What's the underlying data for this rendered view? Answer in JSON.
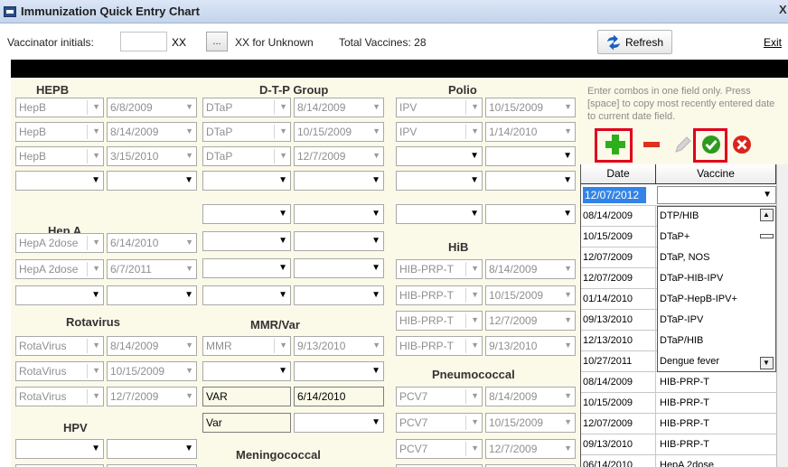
{
  "window": {
    "title": "Immunization Quick Entry Chart",
    "close_label": "X"
  },
  "toolbar": {
    "vaccinator_label": "Vaccinator initials:",
    "vaccinator_value": "",
    "xx_value": "XX",
    "dots_label": "...",
    "xx_unknown_label": "XX for Unknown",
    "total_label": "Total Vaccines: 28",
    "refresh_label": "Refresh",
    "exit_label": "Exit"
  },
  "sections": {
    "hepb": "HEPB",
    "dtp": "D-T-P Group",
    "polio": "Polio",
    "hepa": "Hep A",
    "hib": "HiB",
    "rota": "Rotavirus",
    "mmr": "MMR/Var",
    "pneumo": "Pneumococcal",
    "hpv": "HPV",
    "mening": "Meningococcal"
  },
  "fields": {
    "hepb": [
      [
        "HepB",
        "6/8/2009"
      ],
      [
        "HepB",
        "8/14/2009"
      ],
      [
        "HepB",
        "3/15/2010"
      ]
    ],
    "dtp": [
      [
        "DTaP",
        "8/14/2009"
      ],
      [
        "DTaP",
        "10/15/2009"
      ],
      [
        "DTaP",
        "12/7/2009"
      ]
    ],
    "polio": [
      [
        "IPV",
        "10/15/2009"
      ],
      [
        "IPV",
        "1/14/2010"
      ]
    ],
    "hepa": [
      [
        "HepA 2dose",
        "6/14/2010"
      ],
      [
        "HepA 2dose",
        "6/7/2011"
      ]
    ],
    "hib": [
      [
        "HIB-PRP-T",
        "8/14/2009"
      ],
      [
        "HIB-PRP-T",
        "10/15/2009"
      ],
      [
        "HIB-PRP-T",
        "12/7/2009"
      ],
      [
        "HIB-PRP-T",
        "9/13/2010"
      ]
    ],
    "rota": [
      [
        "RotaVirus",
        "8/14/2009"
      ],
      [
        "RotaVirus",
        "10/15/2009"
      ],
      [
        "RotaVirus",
        "12/7/2009"
      ]
    ],
    "mmr": [
      [
        "MMR",
        "9/13/2010"
      ]
    ],
    "var": [
      [
        "VAR",
        "6/14/2010"
      ],
      [
        "Var",
        ""
      ]
    ],
    "pcv": [
      [
        "PCV7",
        "8/14/2009"
      ],
      [
        "PCV7",
        "10/15/2009"
      ],
      [
        "PCV7",
        "12/7/2009"
      ]
    ]
  },
  "hint": "Enter combos in one field only. Press [space] to copy most recently entered date to current date field.",
  "icons": {
    "add": "plus-icon",
    "remove": "minus-icon",
    "edit": "pencil-icon",
    "confirm": "check-icon",
    "cancel": "cancel-icon",
    "refresh": "refresh-arrows-icon"
  },
  "colors": {
    "add": "#2fae1c",
    "remove": "#e0301e",
    "confirm": "#2e9a20",
    "cancel": "#d9251c",
    "highlight": "#e0001b",
    "selection": "#3384e6"
  },
  "grid": {
    "headers": [
      "Date",
      "Vaccine"
    ],
    "new_row_date": "12/07/2012",
    "rows": [
      [
        "08/14/2009",
        "DTP/HIB"
      ],
      [
        "10/15/2009",
        "DTaP+"
      ],
      [
        "12/07/2009",
        "DTaP, NOS"
      ],
      [
        "12/07/2009",
        "DTaP-HIB-IPV"
      ],
      [
        "01/14/2010",
        "DTaP-HepB-IPV+"
      ],
      [
        "09/13/2010",
        "DTaP-IPV"
      ],
      [
        "12/13/2010",
        "DTaP/HIB"
      ],
      [
        "10/27/2011",
        "Dengue fever"
      ],
      [
        "08/14/2009",
        "HIB-PRP-T"
      ],
      [
        "10/15/2009",
        "HIB-PRP-T"
      ],
      [
        "12/07/2009",
        "HIB-PRP-T"
      ],
      [
        "09/13/2010",
        "HIB-PRP-T"
      ],
      [
        "06/14/2010",
        "HepA 2dose"
      ]
    ]
  }
}
